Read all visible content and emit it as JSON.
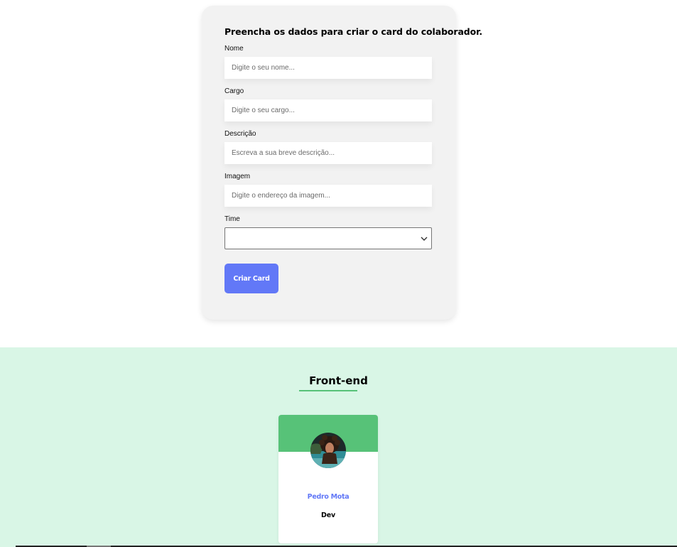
{
  "form": {
    "title": "Preencha os dados para criar o card do colaborador.",
    "fields": [
      {
        "label": "Nome",
        "placeholder": "Digite o seu nome...",
        "value": ""
      },
      {
        "label": "Cargo",
        "placeholder": "Digite o seu cargo...",
        "value": ""
      },
      {
        "label": "Descrição",
        "placeholder": "Escreva a sua breve descrição...",
        "value": ""
      },
      {
        "label": "Imagem",
        "placeholder": "Digite o endereço da imagem...",
        "value": ""
      }
    ],
    "team_select": {
      "label": "Time",
      "selected": ""
    },
    "submit_label": "Criar Card"
  },
  "team": {
    "title": "Front-end",
    "primary_color": "#57c278",
    "secondary_color": "#d9f6e6",
    "members": [
      {
        "name": "Pedro Mota",
        "role": "Dev"
      }
    ]
  },
  "colors": {
    "accent": "#6278f7",
    "form_background": "#f2f2f2"
  }
}
